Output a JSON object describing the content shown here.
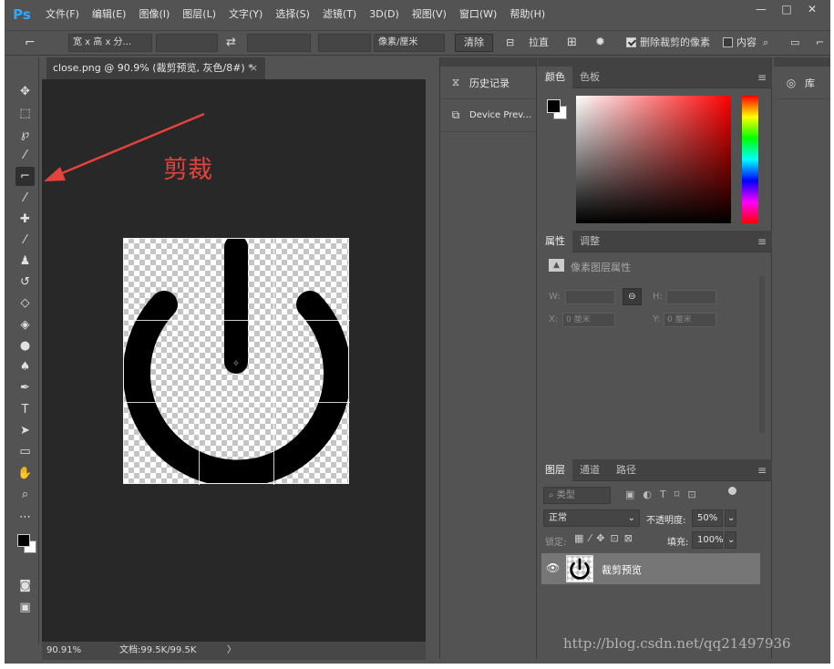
{
  "app": {
    "logo": "Ps"
  },
  "menu": [
    "文件(F)",
    "编辑(E)",
    "图像(I)",
    "图层(L)",
    "文字(Y)",
    "选择(S)",
    "滤镜(T)",
    "3D(D)",
    "视图(V)",
    "窗口(W)",
    "帮助(H)"
  ],
  "window_controls": {
    "minimize": "—",
    "maximize": "□",
    "close": "✕"
  },
  "options": {
    "ratio_select": "宽 x 高 x 分...",
    "unit_select": "像素/厘米",
    "clear_label": "清除",
    "straighten_label": "拉直",
    "delete_cropped_label": "删除裁剪的像素",
    "delete_cropped_checked": true,
    "content_aware_label": "内容",
    "content_aware_checked": false
  },
  "document": {
    "tab_title": "close.png @ 90.9% (裁剪预览, 灰色/8#) *",
    "tab_close": "×",
    "zoom": "90.91%",
    "doc_info": "文档:99.5K/99.5K",
    "status_arrow": "〉"
  },
  "annotation": {
    "text": "剪裁",
    "color": "#e6423c"
  },
  "toolbar": {
    "active_tool": "crop-tool-icon",
    "tools": [
      "move-tool-icon",
      "marquee-tool-icon",
      "lasso-tool-icon",
      "magic-wand-tool-icon",
      "crop-tool-icon",
      "eyedropper-tool-icon",
      "healing-brush-tool-icon",
      "brush-tool-icon",
      "clone-stamp-tool-icon",
      "history-brush-tool-icon",
      "eraser-tool-icon",
      "paint-bucket-tool-icon",
      "blur-tool-icon",
      "dodge-tool-icon",
      "pen-tool-icon",
      "type-tool-icon",
      "path-selection-tool-icon",
      "rectangle-tool-icon",
      "hand-tool-icon",
      "zoom-tool-icon",
      "more-tools-icon",
      "quick-mask-icon",
      "screen-mode-icon"
    ]
  },
  "panels_collapsed": {
    "history": "历史记录",
    "device_preview": "Device Prev..."
  },
  "library": {
    "label": "库"
  },
  "color_panel": {
    "tabs": [
      "颜色",
      "色板"
    ],
    "foreground": "#000000",
    "background": "#ffffff",
    "hue_color": "#ff0000"
  },
  "properties_panel": {
    "tabs": [
      "属性",
      "调整"
    ],
    "title": "像素图层属性",
    "w_label": "W:",
    "h_label": "H:",
    "x_label": "X:",
    "y_label": "Y:",
    "x_value": "0 厘米",
    "y_value": "0 厘米"
  },
  "layers_panel": {
    "tabs": [
      "图层",
      "通道",
      "路径"
    ],
    "filter_placeholder": "类型",
    "blend_mode": "正常",
    "opacity_label": "不透明度:",
    "opacity_value": "50%",
    "lock_label": "锁定:",
    "fill_label": "填充:",
    "fill_value": "100%",
    "layers": [
      {
        "name": "裁剪预览",
        "visible": true
      }
    ]
  },
  "watermark": "http://blog.csdn.net/qq21497936"
}
